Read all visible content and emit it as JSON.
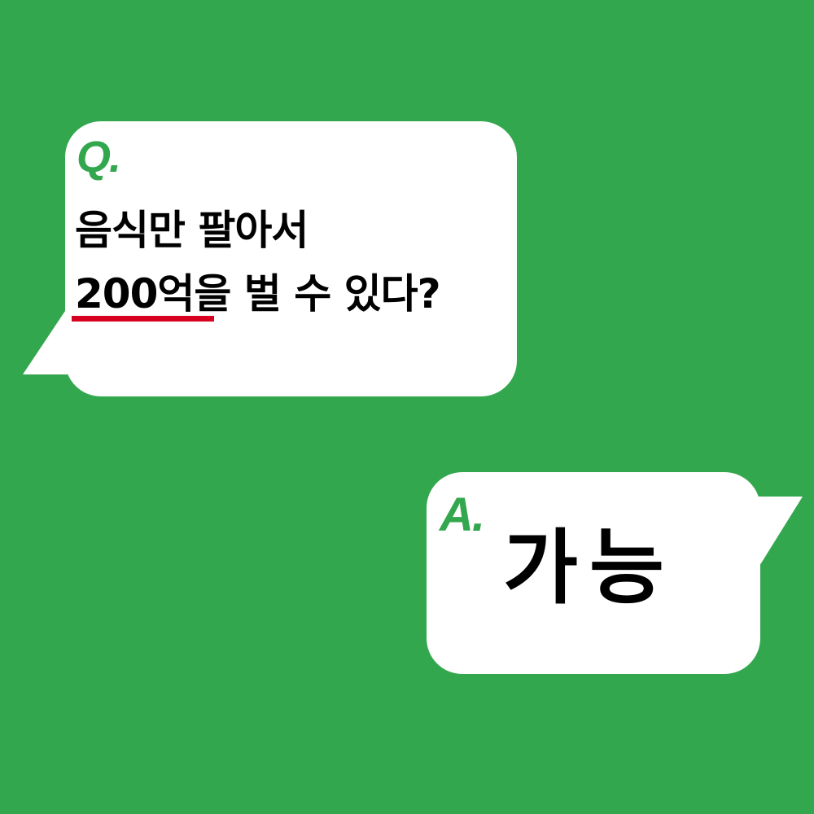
{
  "colors": {
    "background": "#33a74e",
    "bubble": "#ffffff",
    "accent": "#33a74e",
    "text": "#000000",
    "underline": "#d7001f"
  },
  "question": {
    "marker": "Q.",
    "line1": "음식만 팔아서",
    "line2_highlight": "200억",
    "line2_rest": "을 벌 수 있다?"
  },
  "answer": {
    "marker": "A.",
    "text": "가능"
  }
}
